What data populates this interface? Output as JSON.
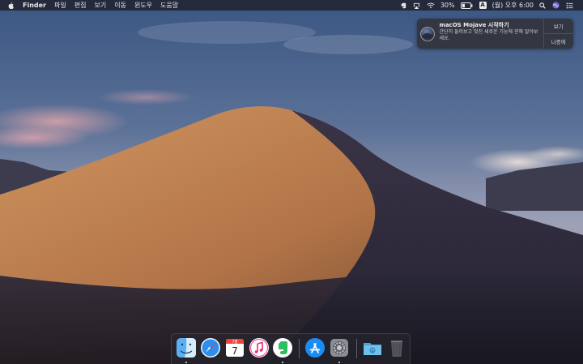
{
  "menubar": {
    "app_name": "Finder",
    "menus": [
      "파일",
      "편집",
      "보기",
      "이동",
      "윈도우",
      "도움말"
    ],
    "battery_text": "30%",
    "input_source": "A",
    "clock": "(월) 오후 6:00"
  },
  "notification": {
    "title": "macOS Mojave 시작하기",
    "body": "간단히 둘러보고 멋진 새로운 기능에 관해 알아보세요.",
    "actions": [
      "보기",
      "나중에"
    ]
  },
  "dock": {
    "calendar": {
      "month": "7월",
      "day": "7"
    },
    "apps": [
      "Finder",
      "Safari",
      "캘린더",
      "iTunes",
      "Evernote",
      "App Store",
      "시스템 환경설정",
      "다운로드",
      "휴지통"
    ]
  },
  "colors": {
    "sky_top": "#3c5a88",
    "sky_bottom": "#a7a4b8",
    "dune_light": "#c78a5a",
    "dune_dark": "#2b2838",
    "menubar": "#1e1e26"
  }
}
